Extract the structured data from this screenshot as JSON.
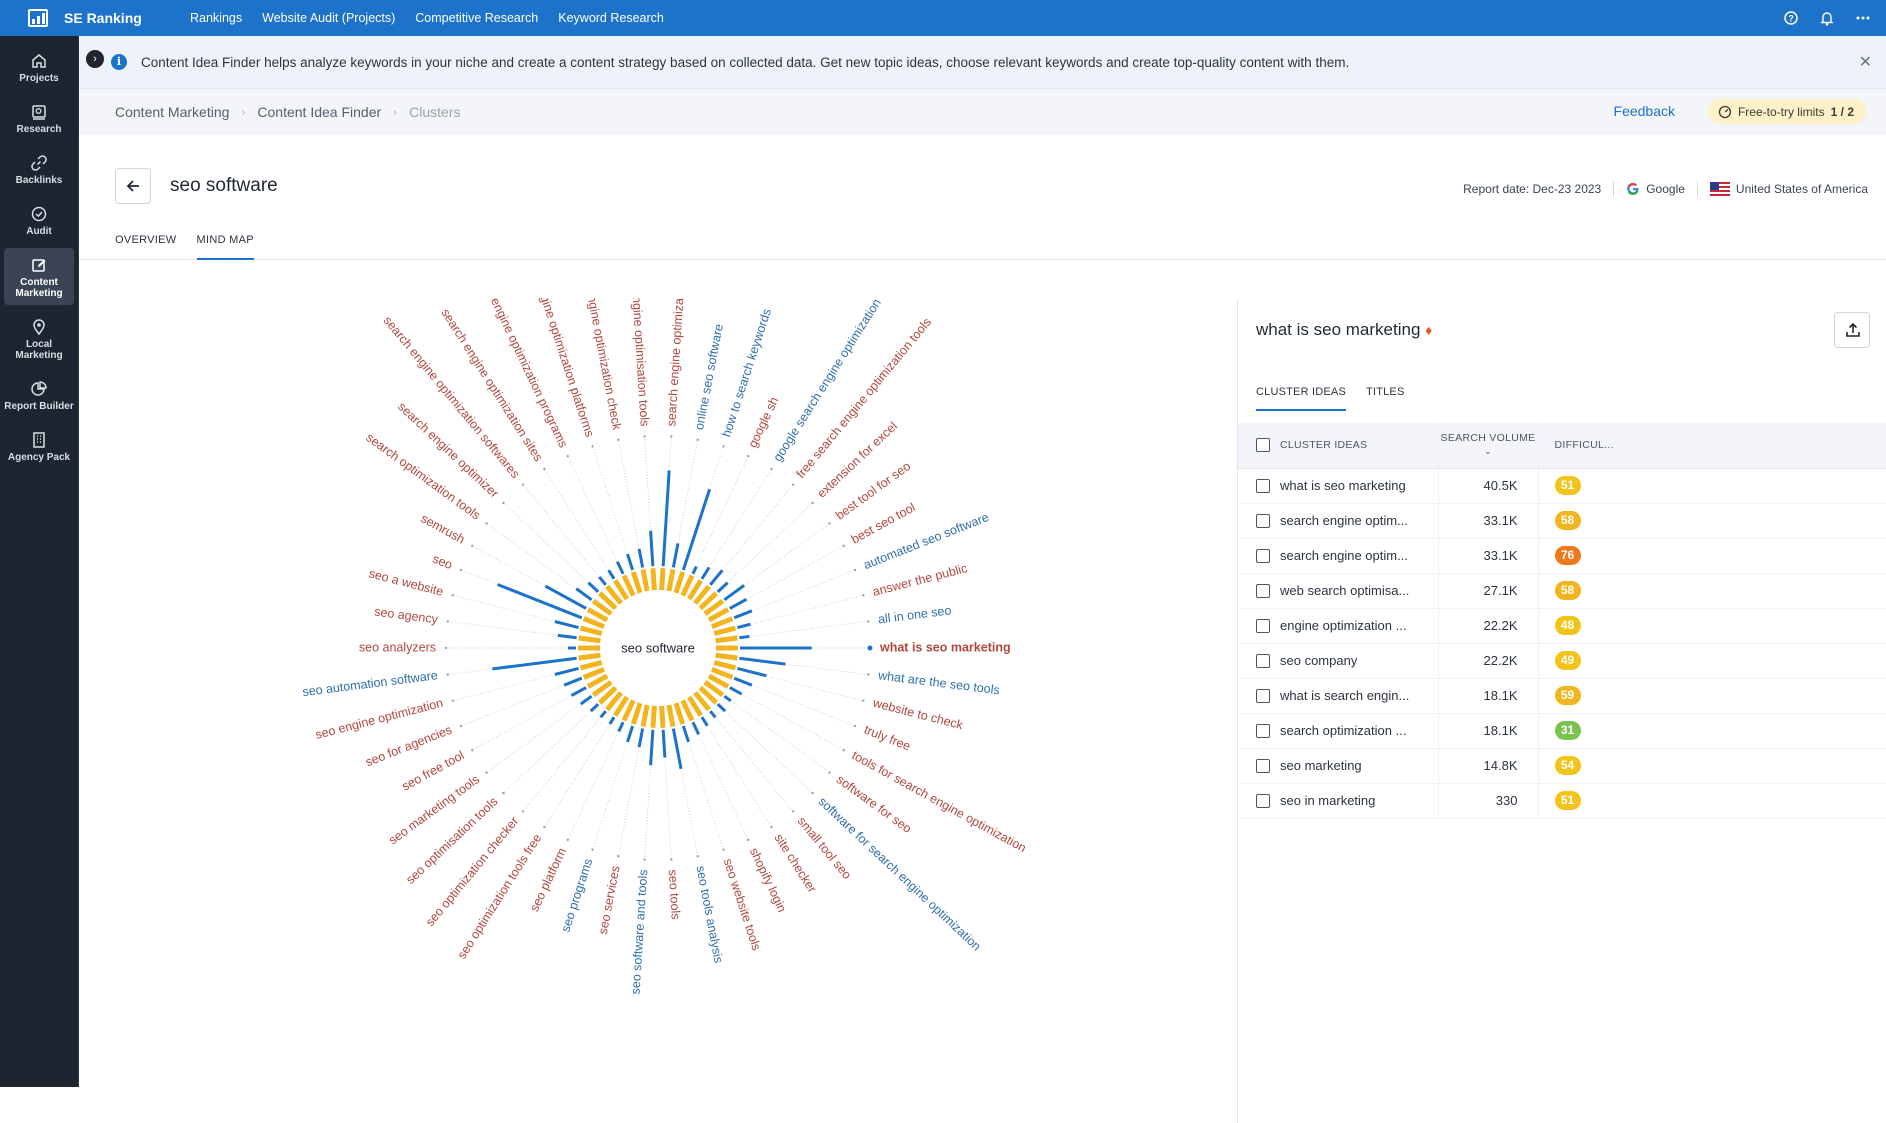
{
  "topbar": {
    "brand": "SE Ranking",
    "nav": [
      "Rankings",
      "Website Audit (Projects)",
      "Competitive Research",
      "Keyword Research"
    ],
    "icons": [
      "help-icon",
      "bell-icon",
      "more-icon"
    ]
  },
  "sidebar": {
    "items": [
      {
        "label": "Projects",
        "icon": "home-icon"
      },
      {
        "label": "Research",
        "icon": "research-icon"
      },
      {
        "label": "Backlinks",
        "icon": "link-icon"
      },
      {
        "label": "Audit",
        "icon": "check-circle-icon"
      },
      {
        "label": "Content Marketing",
        "icon": "edit-icon",
        "active": true
      },
      {
        "label": "Local Marketing",
        "icon": "pin-icon"
      },
      {
        "label": "Report Builder",
        "icon": "chart-icon"
      },
      {
        "label": "Agency Pack",
        "icon": "building-icon"
      }
    ]
  },
  "info": {
    "text": "Content Idea Finder helps analyze keywords in your niche and create a content strategy based on collected data. Get new topic ideas, choose relevant keywords and create top-quality content with them."
  },
  "breadcrumb": [
    "Content Marketing",
    "Content Idea Finder",
    "Clusters"
  ],
  "feedback": "Feedback",
  "limits": {
    "label": "Free-to-try limits",
    "value": "1 / 2"
  },
  "title": "seo software",
  "report": {
    "date": "Report date: Dec-23 2023",
    "engine": "Google",
    "country": "United States of America"
  },
  "tabs": [
    "OVERVIEW",
    "MIND MAP"
  ],
  "mindmap": {
    "center": "seo software",
    "selected": "what is seo marketing",
    "colors": {
      "red": "#b2473f",
      "blue": "#2f6fad",
      "bar_yellow": "#f2b51f",
      "bar_blue": "#1d72c9"
    },
    "labels": [
      {
        "text": "what is seo marketing",
        "color": "red",
        "bar": 0.78,
        "selected": true
      },
      {
        "text": "what are the seo tools",
        "color": "blue",
        "bar": 0.55
      },
      {
        "text": "website to check",
        "color": "red",
        "bar": 0.4
      },
      {
        "text": "truly free",
        "color": "red",
        "bar": 0.3
      },
      {
        "text": "tools for search engine optimization",
        "color": "red",
        "bar": 0.25
      },
      {
        "text": "software for seo",
        "color": "red",
        "bar": 0.2
      },
      {
        "text": "software for search engine optimization",
        "color": "blue",
        "bar": 0.22
      },
      {
        "text": "small tool seo",
        "color": "red",
        "bar": 0.2
      },
      {
        "text": "site checker",
        "color": "red",
        "bar": 0.22
      },
      {
        "text": "shopify login",
        "color": "red",
        "bar": 0.25
      },
      {
        "text": "seo website tools",
        "color": "red",
        "bar": 0.28
      },
      {
        "text": "seo tools analysis",
        "color": "blue",
        "bar": 0.5
      },
      {
        "text": "seo tools",
        "color": "red",
        "bar": 0.38
      },
      {
        "text": "seo software and tools",
        "color": "blue",
        "bar": 0.45
      },
      {
        "text": "seo services",
        "color": "red",
        "bar": 0.3
      },
      {
        "text": "seo programs",
        "color": "blue",
        "bar": 0.28
      },
      {
        "text": "seo platform",
        "color": "red",
        "bar": 0.22
      },
      {
        "text": "seo optimization tools free",
        "color": "red",
        "bar": 0.2
      },
      {
        "text": "seo optimization checker",
        "color": "red",
        "bar": 0.2
      },
      {
        "text": "seo optimisation tools",
        "color": "red",
        "bar": 0.22
      },
      {
        "text": "seo marketing tools",
        "color": "red",
        "bar": 0.25
      },
      {
        "text": "seo free tool",
        "color": "red",
        "bar": 0.28
      },
      {
        "text": "seo for agencies",
        "color": "red",
        "bar": 0.3
      },
      {
        "text": "seo engine optimization",
        "color": "red",
        "bar": 0.35
      },
      {
        "text": "seo automation software",
        "color": "blue",
        "bar": 0.9
      },
      {
        "text": "seo analyzers",
        "color": "red",
        "bar": 0.2
      },
      {
        "text": "seo agency",
        "color": "red",
        "bar": 0.3
      },
      {
        "text": "seo a website",
        "color": "red",
        "bar": 0.35
      },
      {
        "text": "seo",
        "color": "red",
        "bar": 0.95
      },
      {
        "text": "semrush",
        "color": "red",
        "bar": 0.55
      },
      {
        "text": "search optimization tools",
        "color": "red",
        "bar": 0.3
      },
      {
        "text": "search engine optimizer",
        "color": "red",
        "bar": 0.25
      },
      {
        "text": "search engine optimization softwares",
        "color": "red",
        "bar": 0.22
      },
      {
        "text": "search engine optimization sites",
        "color": "red",
        "bar": 0.22
      },
      {
        "text": "search engine optimization programs",
        "color": "red",
        "bar": 0.25
      },
      {
        "text": "search engine optimization platforms",
        "color": "red",
        "bar": 0.28
      },
      {
        "text": "search engine optimization check",
        "color": "red",
        "bar": 0.3
      },
      {
        "text": "search engine optimisation tools",
        "color": "red",
        "bar": 0.45
      },
      {
        "text": "search engine optimization",
        "color": "red",
        "bar": 1.0
      },
      {
        "text": "online seo software",
        "color": "blue",
        "bar": 0.35
      },
      {
        "text": "how to search keywords",
        "color": "blue",
        "bar": 0.9
      },
      {
        "text": "google sh",
        "color": "red",
        "bar": 0.2
      },
      {
        "text": "google search engine optimization",
        "color": "blue",
        "bar": 0.25
      },
      {
        "text": "free search engine optimization tools",
        "color": "red",
        "bar": 0.3
      },
      {
        "text": "extension for excel",
        "color": "red",
        "bar": 0.25
      },
      {
        "text": "best tool for seo",
        "color": "red",
        "bar": 0.35
      },
      {
        "text": "best seo tool",
        "color": "red",
        "bar": 0.3
      },
      {
        "text": "automated seo software",
        "color": "blue",
        "bar": 0.3
      },
      {
        "text": "answer the public",
        "color": "red",
        "bar": 0.25
      },
      {
        "text": "all in one seo",
        "color": "blue",
        "bar": 0.22
      }
    ]
  },
  "panel": {
    "title": "what is seo marketing",
    "tabs": [
      "CLUSTER IDEAS",
      "TITLES"
    ],
    "columns": [
      "CLUSTER IDEAS",
      "SEARCH VOLUME",
      "DIFFICUL..."
    ],
    "rows": [
      {
        "idea": "what is seo marketing",
        "volume": "40.5K",
        "difficulty": "51",
        "color": "#f2c318"
      },
      {
        "idea": "search engine optim...",
        "volume": "33.1K",
        "difficulty": "58",
        "color": "#f2b51f"
      },
      {
        "idea": "search engine optim...",
        "volume": "33.1K",
        "difficulty": "76",
        "color": "#ee7a1c"
      },
      {
        "idea": "web search optimisa...",
        "volume": "27.1K",
        "difficulty": "58",
        "color": "#f2b51f"
      },
      {
        "idea": "engine optimization ...",
        "volume": "22.2K",
        "difficulty": "48",
        "color": "#f2c318"
      },
      {
        "idea": "seo company",
        "volume": "22.2K",
        "difficulty": "49",
        "color": "#f2c318"
      },
      {
        "idea": "what is search engin...",
        "volume": "18.1K",
        "difficulty": "59",
        "color": "#f2b51f"
      },
      {
        "idea": "search optimization ...",
        "volume": "18.1K",
        "difficulty": "31",
        "color": "#7cc24e"
      },
      {
        "idea": "seo marketing",
        "volume": "14.8K",
        "difficulty": "54",
        "color": "#f2c318"
      },
      {
        "idea": "seo in marketing",
        "volume": "330",
        "difficulty": "51",
        "color": "#f2c318"
      }
    ]
  }
}
